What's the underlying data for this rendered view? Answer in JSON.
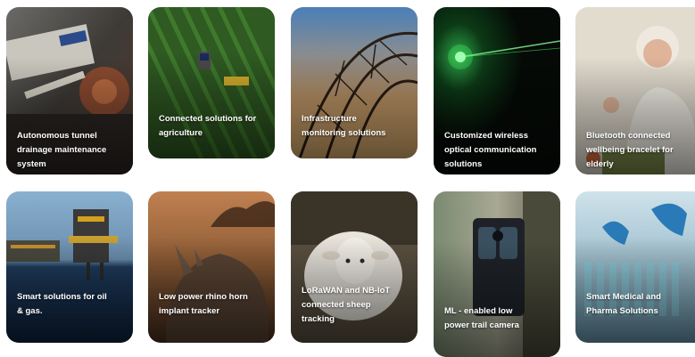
{
  "cards": [
    {
      "label": "Autonomous tunnel\ndrainage maintenance\nsystem",
      "image": "tunnel-machinery-image"
    },
    {
      "label": "Connected solutions for\nagriculture",
      "image": "tractor-field-image"
    },
    {
      "label": "Infrastructure\nmonitoring solutions",
      "image": "steel-structure-image"
    },
    {
      "label": "Customized wireless\noptical communication\nsolutions",
      "image": "green-laser-image"
    },
    {
      "label": "Bluetooth connected\nwellbeing bracelet for\nelderly",
      "image": "elderly-woman-image"
    },
    {
      "label": "Smart solutions for oil\n& gas.",
      "image": "oil-rig-image"
    },
    {
      "label": "Low power rhino horn\nimplant tracker",
      "image": "rhino-image"
    },
    {
      "label": "LoRaWAN and NB-IoT\nconnected sheep\ntracking",
      "image": "sheep-image"
    },
    {
      "label": "ML - enabled low\npower trail camera",
      "image": "trail-camera-image"
    },
    {
      "label": "Smart Medical and\nPharma Solutions",
      "image": "lab-glassware-image"
    }
  ]
}
